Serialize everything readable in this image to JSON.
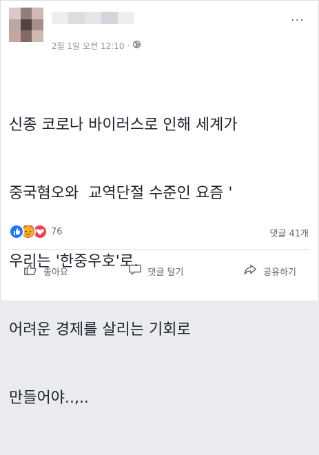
{
  "post": {
    "timestamp": "2월 1일 오전 12:10",
    "separator": "·",
    "more_label": "···",
    "text_lines": [
      "신종 코로나 바이러스로 인해 세계가",
      "중국혐오와  교역단절 수준인 요즘 '",
      "우리는 '한중우호'로.",
      "어려운 경제를 살리는 기회로",
      "만들어야..,.."
    ]
  },
  "stats": {
    "reaction_count": "76",
    "comments": "댓글 41개"
  },
  "actions": {
    "like": "좋아요",
    "comment": "댓글 달기",
    "share": "공유하기"
  },
  "colors": {
    "like": "#2078f4",
    "angry": "#f0543a",
    "love": "#f33e58",
    "muted": "#606770"
  },
  "icons": [
    "globe-icon",
    "like-reaction-icon",
    "angry-reaction-icon",
    "love-reaction-icon",
    "thumbs-up-icon",
    "comment-icon",
    "share-icon"
  ]
}
